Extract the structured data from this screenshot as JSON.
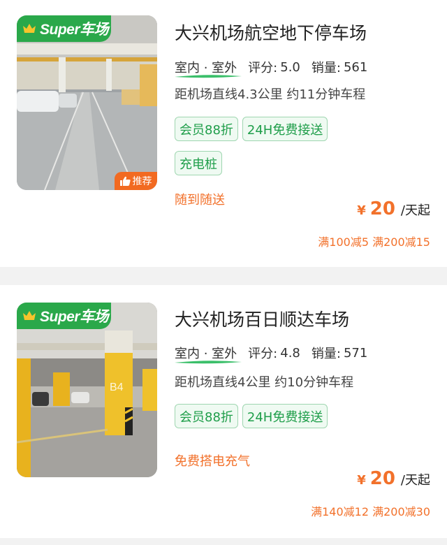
{
  "colors": {
    "brand_green": "#2aa84a",
    "accent_orange": "#f2712b",
    "tag_green": "#1f9e4a"
  },
  "listings": [
    {
      "badge": "Super车场",
      "badge_icon": "crown-icon",
      "recommend_label": "推荐",
      "recommend_icon": "thumbs-up-icon",
      "name": "大兴机场航空地下停车场",
      "type": "室内 · 室外",
      "rating_label": "评分:",
      "rating": "5.0",
      "sales_label": "销量:",
      "sales": "561",
      "distance": "距机场直线4.3公里 约11分钟车程",
      "tags": [
        "会员88折",
        "24H免费接送",
        "充电桩"
      ],
      "note": "随到随送",
      "currency": "¥",
      "price": "20",
      "price_unit": "/天起",
      "discount": "满100减5 满200减15"
    },
    {
      "badge": "Super车场",
      "badge_icon": "crown-icon",
      "name": "大兴机场百日顺达车场",
      "type": "室内 · 室外",
      "rating_label": "评分:",
      "rating": "4.8",
      "sales_label": "销量:",
      "sales": "571",
      "distance": "距机场直线4公里 约10分钟车程",
      "tags": [
        "会员88折",
        "24H免费接送"
      ],
      "note": "免费搭电充气",
      "currency": "¥",
      "price": "20",
      "price_unit": "/天起",
      "discount": "满140减12 满200减30"
    }
  ]
}
